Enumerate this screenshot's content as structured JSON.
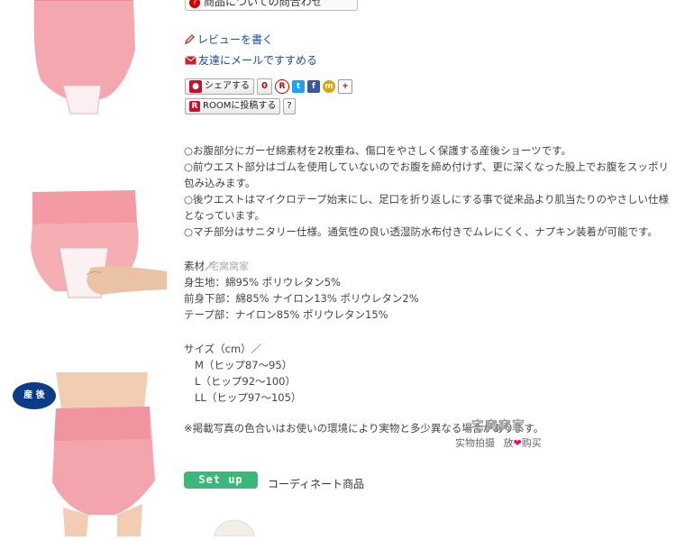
{
  "inquiry_button": "商品についての問合わせ",
  "review_link": "レビューを書く",
  "mail_link": "友達にメールですすめる",
  "share": {
    "share_label": "シェアする",
    "count": "0",
    "room_label": "ROOMに投稿する",
    "help": "?"
  },
  "description": [
    "○お腹部分にガーゼ綿素材を2枚重ね、傷口をやさしく保護する産後ショーツです。",
    "○前ウエスト部分はゴムを使用していないのでお腹を締め付けず、更に深くなった股上でお腹をスッポリ包み込みます。",
    "○後ウエストはマイクロテープ始末にし、足口を折り返しにする事で従来品より肌当たりのやさしい仕様となっています。",
    "○マチ部分はサニタリー仕様。通気性の良い透湿防水布付きでムレにくく、ナプキン装着が可能です。"
  ],
  "materials": {
    "heading": "素材／",
    "lines": [
      "身生地：綿95% ポリウレタン5%",
      "前身下部：綿85% ナイロン13% ポリウレタン2%",
      "テープ部：ナイロン85% ポリウレタン15%"
    ]
  },
  "sizes": {
    "heading": "サイズ（cm）／",
    "lines": [
      "M（ヒップ87～95）",
      "L（ヒップ92～100）",
      "LL（ヒップ97～105）"
    ]
  },
  "note": "※掲載写真の色合いはお使いの環境により実物と多少異なる場合があります。",
  "watermark": {
    "brand": "宅窝窝家",
    "caption_left": "实物拍摄",
    "caption_right": "放",
    "caption_end": "购买"
  },
  "badge": "産 後",
  "setup_label": "Set up",
  "coordinate_label": "コーディネート商品",
  "colors": {
    "pink": "#f4a7ae",
    "link": "#1a4f9c",
    "setup_green": "#3bb879",
    "badge_navy": "#0d3b86"
  }
}
